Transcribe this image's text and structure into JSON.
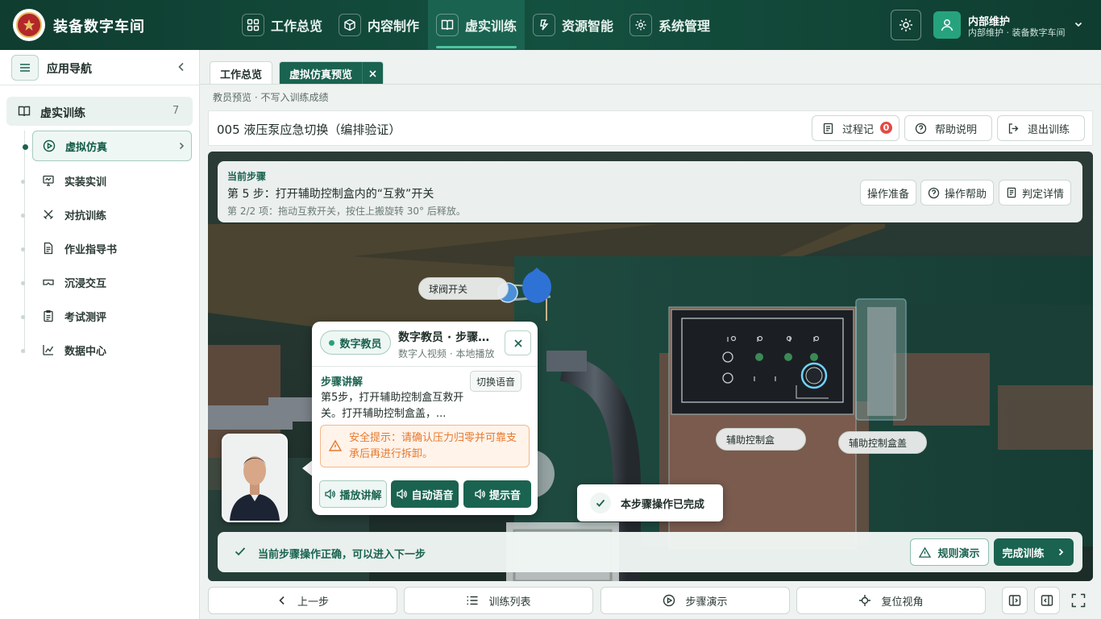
{
  "header": {
    "app_title": "装备数字车间",
    "nav": [
      {
        "label": "工作总览",
        "icon": "grid-icon"
      },
      {
        "label": "内容制作",
        "icon": "cube-icon"
      },
      {
        "label": "虚实训练",
        "icon": "book-icon",
        "active": true
      },
      {
        "label": "资源智能",
        "icon": "lightning-icon"
      },
      {
        "label": "系统管理",
        "icon": "gear-icon"
      }
    ],
    "user": {
      "name": "内部维护",
      "subtitle": "内部维护 · 装备数字车间"
    }
  },
  "sidebar": {
    "title": "应用导航",
    "group": {
      "label": "虚实训练",
      "count": "7"
    },
    "items": [
      {
        "label": "虚拟仿真",
        "active": true
      },
      {
        "label": "实装实训"
      },
      {
        "label": "对抗训练"
      },
      {
        "label": "作业指导书"
      },
      {
        "label": "沉浸交互"
      },
      {
        "label": "考试测评"
      },
      {
        "label": "数据中心"
      }
    ]
  },
  "tabs": [
    {
      "label": "工作总览"
    },
    {
      "label": "虚拟仿真预览",
      "active": true
    }
  ],
  "preview_note": "教员预览 · 不写入训练成绩",
  "course": {
    "title": "005 液压泵应急切换（编排验证）",
    "buttons": {
      "process_log": "过程记",
      "process_badge": "0",
      "help": "帮助说明",
      "exit": "退出训练"
    }
  },
  "step": {
    "caption": "当前步骤",
    "title": "第 5 步：打开辅助控制盒内的“互救”开关",
    "sub": "第 2/2 项：拖动互救开关，按住上搬旋转 30° 后释放。",
    "buttons": {
      "prep": "操作准备",
      "help": "操作帮助",
      "judge": "判定详情"
    }
  },
  "scene_labels": {
    "ball_valve": "球阀开关",
    "aux_box": "辅助控制盒",
    "aux_lid": "辅助控制盒盖"
  },
  "teacher": {
    "tag": "数字教员",
    "title": "数字教员 · 步骤讲解",
    "subtitle": "数字人视频 · 本地播放",
    "explain_caption": "步骤讲解",
    "switch_voice": "切换语音",
    "explain_text": "第5步，打开辅助控制盒互救开关。打开辅助控制盒盖，...",
    "safety": "安全提示：请确认压力归零并可靠支承后再进行拆卸。",
    "buttons": {
      "play": "播放讲解",
      "auto_voice": "自动语音",
      "tone": "提示音"
    }
  },
  "toast": "本步骤操作已完成",
  "status": {
    "message": "当前步骤操作正确，可以进入下一步",
    "rule": "规则演示",
    "finish": "完成训练"
  },
  "bottom": {
    "prev": "上一步",
    "list": "训练列表",
    "demo": "步骤演示",
    "reset": "复位视角"
  },
  "colors": {
    "primary": "#1a6350",
    "header_bg": "#0f3d30",
    "warning": "#e67a2e",
    "badge": "#e34a43"
  }
}
